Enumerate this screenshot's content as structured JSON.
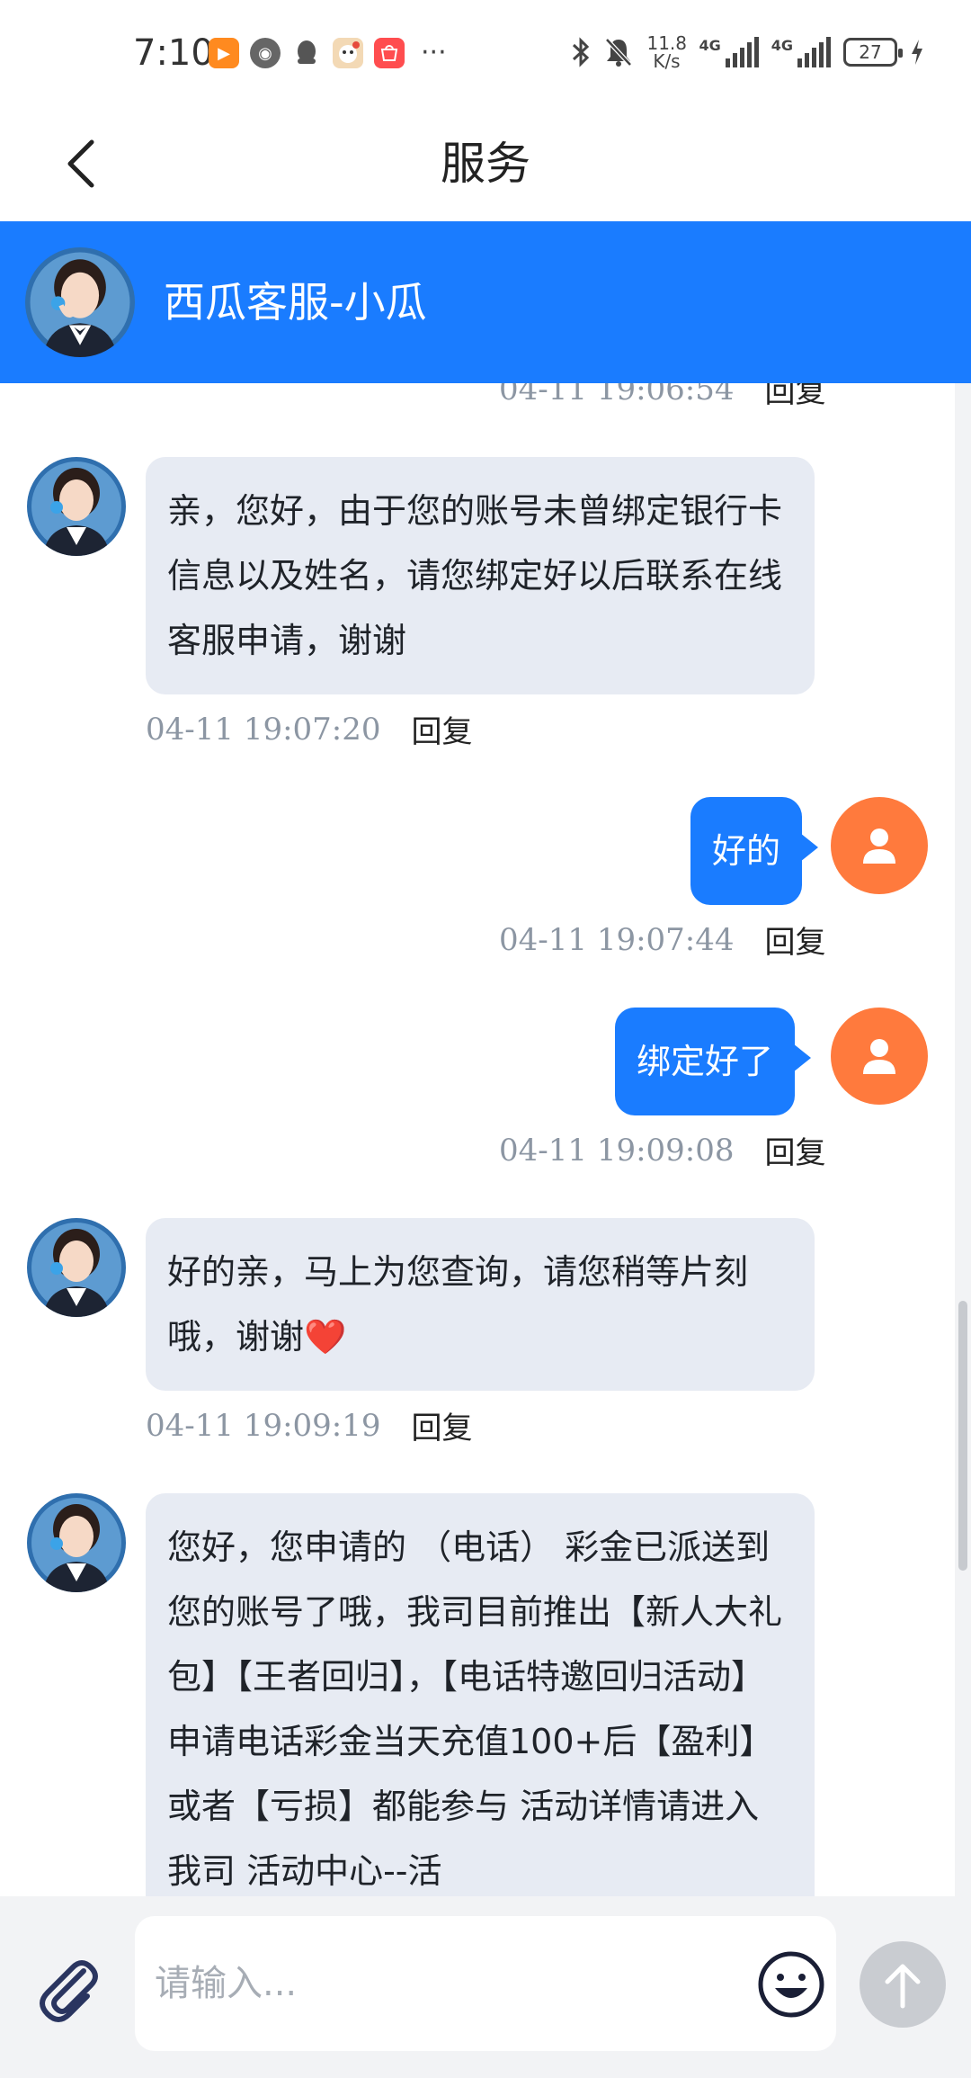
{
  "status_bar": {
    "time": "7:10",
    "net_speed_value": "11.8",
    "net_speed_unit": "K/s",
    "network_1": "4G",
    "network_2": "4G",
    "battery": "27",
    "overflow": "···"
  },
  "nav": {
    "title": "服务"
  },
  "agent": {
    "name": "西瓜客服-小瓜"
  },
  "messages": [
    {
      "side": "in",
      "timestamp": "04-11 19:06:54",
      "reply": "回复"
    },
    {
      "side": "in",
      "text": "亲，您好，由于您的账号未曾绑定银行卡信息以及姓名，请您绑定好以后联系在线客服申请，谢谢",
      "timestamp": "04-11 19:07:20",
      "reply": "回复"
    },
    {
      "side": "out",
      "text": "好的",
      "timestamp": "04-11 19:07:44",
      "reply": "回复"
    },
    {
      "side": "out",
      "text": "绑定好了",
      "timestamp": "04-11 19:09:08",
      "reply": "回复"
    },
    {
      "side": "in",
      "text": "好的亲，马上为您查询，请您稍等片刻哦，谢谢",
      "emoji": "❤️",
      "timestamp": "04-11 19:09:19",
      "reply": "回复"
    },
    {
      "side": "in",
      "text": "您好，您申请的 （电话） 彩金已派送到您的账号了哦，我司目前推出【新人大礼包】【王者回归】，【电话特邀回归活动】申请电话彩金当天充值100+后【盈利】或者【亏损】都能参与  活动详情请进入我司 活动中心--活"
    }
  ],
  "input": {
    "placeholder": "请输入..."
  },
  "colors": {
    "accent": "#1a7cff",
    "user_avatar": "#ff7a3d",
    "incoming_bubble": "#e7ebf3",
    "timestamp": "#8c96a3"
  },
  "icons": {
    "back": "chevron-left-icon",
    "attach": "paperclip-icon",
    "emoji": "smiley-icon",
    "send": "arrow-up-icon",
    "user": "person-icon"
  }
}
